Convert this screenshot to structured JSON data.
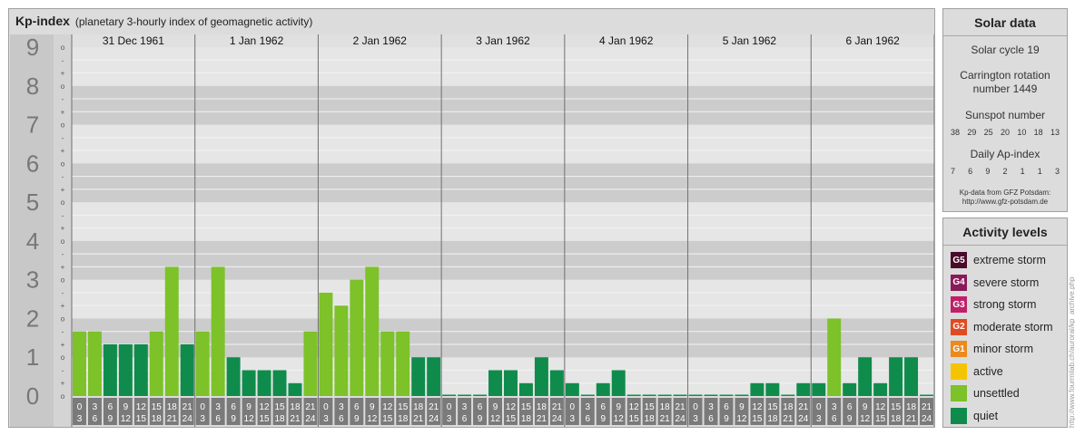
{
  "header": {
    "title": "Kp-index",
    "subtitle": "(planetary 3-hourly index of geomagnetic activity)"
  },
  "chart_data": {
    "type": "bar",
    "title": "Kp-index",
    "subtitle": "(planetary 3-hourly index of geomagnetic activity)",
    "ylim": [
      0,
      9
    ],
    "y_ticks": [
      "0",
      "1",
      "2",
      "3",
      "4",
      "5",
      "6",
      "7",
      "8",
      "9"
    ],
    "y_minor_ticks": [
      "o",
      "+",
      "-"
    ],
    "days": [
      "31 Dec 1961",
      "1 Jan 1962",
      "2 Jan 1962",
      "3 Jan 1962",
      "4 Jan 1962",
      "5 Jan 1962",
      "6 Jan 1962"
    ],
    "interval_labels": [
      {
        "start": "0",
        "end": "3"
      },
      {
        "start": "3",
        "end": "6"
      },
      {
        "start": "6",
        "end": "9"
      },
      {
        "start": "9",
        "end": "12"
      },
      {
        "start": "12",
        "end": "15"
      },
      {
        "start": "15",
        "end": "18"
      },
      {
        "start": "18",
        "end": "21"
      },
      {
        "start": "21",
        "end": "24"
      }
    ],
    "values": [
      [
        1.667,
        1.667,
        1.333,
        1.333,
        1.333,
        1.667,
        3.333,
        1.333
      ],
      [
        1.667,
        3.333,
        1.0,
        0.667,
        0.667,
        0.667,
        0.333,
        1.667
      ],
      [
        2.667,
        2.333,
        3.0,
        3.333,
        1.667,
        1.667,
        1.0,
        1.0
      ],
      [
        0.0,
        0.0,
        0.0,
        0.667,
        0.667,
        0.333,
        1.0,
        0.667
      ],
      [
        0.333,
        0.0,
        0.333,
        0.667,
        0.0,
        0.0,
        0.0,
        0.0
      ],
      [
        0.0,
        0.0,
        0.0,
        0.0,
        0.333,
        0.333,
        0.0,
        0.333
      ],
      [
        0.333,
        2.0,
        0.333,
        1.0,
        0.333,
        1.0,
        1.0,
        0.0
      ]
    ],
    "colors": {
      "quiet": "#0f8c4b",
      "unsettled": "#7cc228",
      "active": "#f5c400"
    }
  },
  "solar": {
    "title": "Solar data",
    "cycle": "Solar cycle 19",
    "carrington_line1": "Carrington rotation",
    "carrington_line2": "number 1449",
    "sunspot_label": "Sunspot number",
    "sunspot_values": [
      "38",
      "29",
      "25",
      "20",
      "10",
      "18",
      "13"
    ],
    "ap_label": "Daily Ap-index",
    "ap_values": [
      "7",
      "6",
      "9",
      "2",
      "1",
      "1",
      "3"
    ],
    "credit_line1": "Kp-data from GFZ Potsdam:",
    "credit_line2": "http://www.gfz-potsdam.de"
  },
  "activity": {
    "title": "Activity levels",
    "items": [
      {
        "code": "G5",
        "label": "extreme storm",
        "color": "#4a0a2a"
      },
      {
        "code": "G4",
        "label": "severe storm",
        "color": "#8a1a5a"
      },
      {
        "code": "G3",
        "label": "strong storm",
        "color": "#c02068"
      },
      {
        "code": "G2",
        "label": "moderate storm",
        "color": "#e04a22"
      },
      {
        "code": "G1",
        "label": "minor storm",
        "color": "#ec8a1e"
      },
      {
        "code": "",
        "label": "active",
        "color": "#f5c400"
      },
      {
        "code": "",
        "label": "unsettled",
        "color": "#7cc228"
      },
      {
        "code": "",
        "label": "quiet",
        "color": "#0f8c4b"
      }
    ]
  },
  "watermark": "http://www.fourmilab.ch/auroral/kp_archive.php"
}
